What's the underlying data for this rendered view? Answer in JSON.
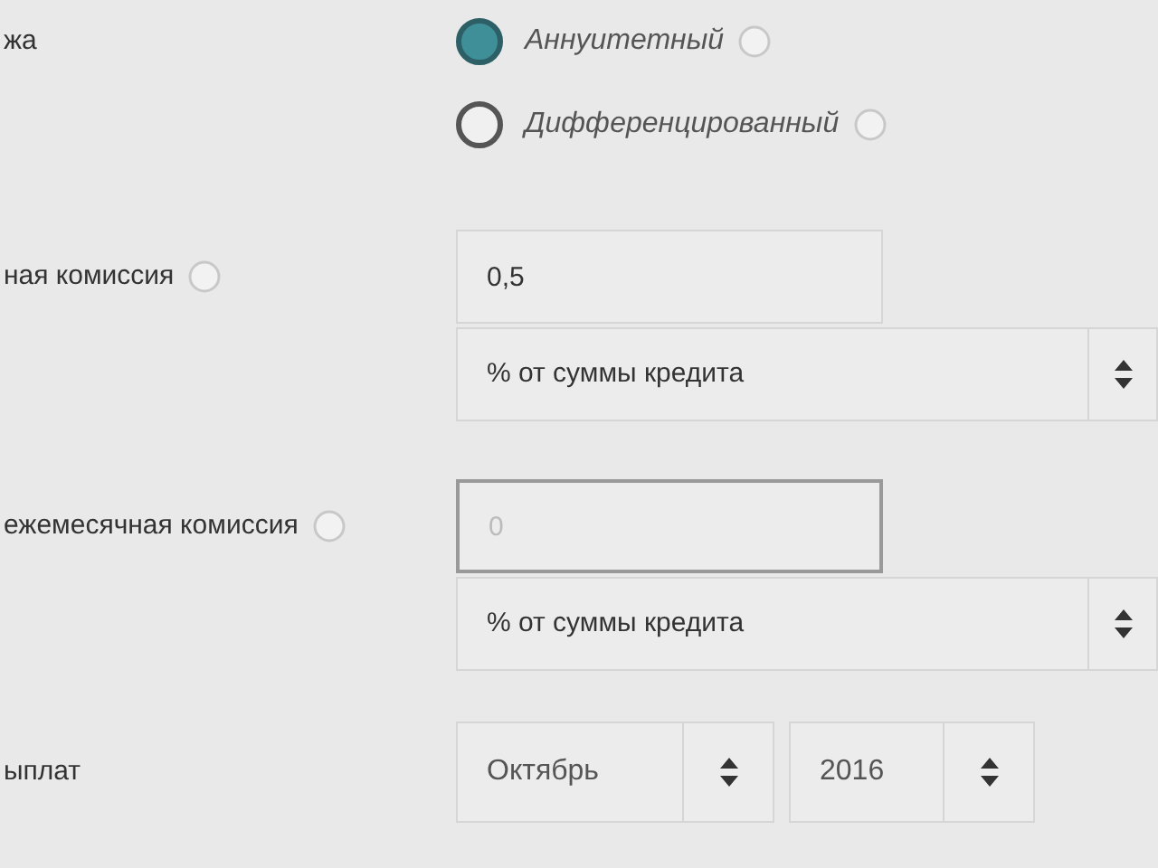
{
  "payment_type": {
    "label": "жа",
    "options": [
      {
        "label": "Аннуитетный",
        "selected": true,
        "help": true
      },
      {
        "label": "Дифференцированный",
        "selected": false,
        "help": true
      }
    ]
  },
  "fees": [
    {
      "label": "ная комиссия",
      "help": true,
      "value": "0,5",
      "focused": false,
      "unit": "% от суммы кредита"
    },
    {
      "label": "ежемесячная комиссия",
      "help": true,
      "placeholder": "0",
      "focused": true,
      "unit": "% от суммы кредита"
    }
  ],
  "start": {
    "label": "ыплат",
    "month": "Октябрь",
    "year": "2016"
  }
}
